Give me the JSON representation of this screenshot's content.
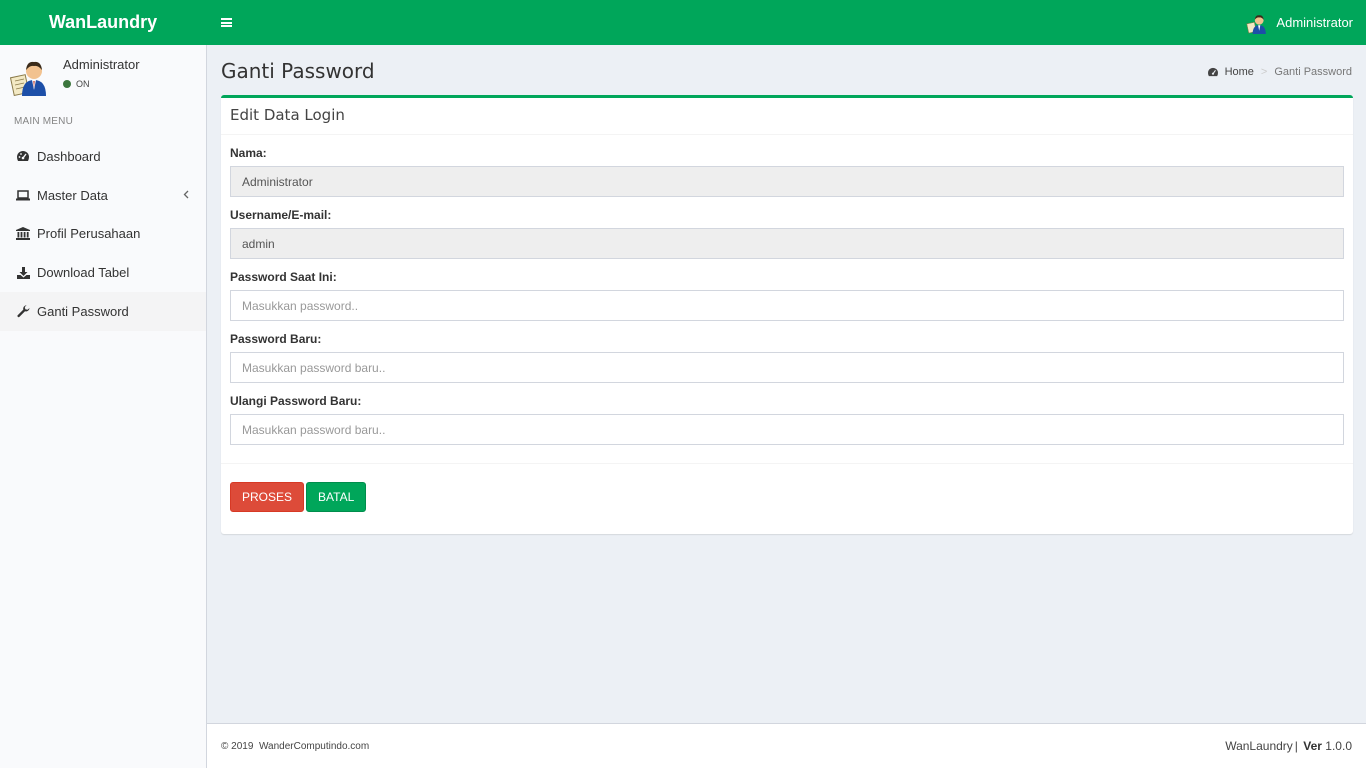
{
  "app": {
    "brand": "WanLaundry"
  },
  "header": {
    "user_name": "Administrator"
  },
  "sidebar": {
    "user_name": "Administrator",
    "status": "ON",
    "menu_header": "MAIN MENU",
    "items": [
      {
        "label": "Dashboard",
        "icon": "dashboard-icon"
      },
      {
        "label": "Master Data",
        "icon": "laptop-icon"
      },
      {
        "label": "Profil Perusahaan",
        "icon": "bank-icon"
      },
      {
        "label": "Download Tabel",
        "icon": "download-icon"
      },
      {
        "label": "Ganti Password",
        "icon": "wrench-icon"
      }
    ]
  },
  "page": {
    "title": "Ganti Password",
    "breadcrumb": {
      "home": "Home",
      "current": "Ganti Password"
    }
  },
  "box": {
    "title": "Edit Data Login"
  },
  "form": {
    "nama_label": "Nama:",
    "nama_value": "Administrator",
    "username_label": "Username/E-mail:",
    "username_value": "admin",
    "current_password_label": "Password Saat Ini:",
    "current_password_placeholder": "Masukkan password..",
    "new_password_label": "Password Baru:",
    "new_password_placeholder": "Masukkan password baru..",
    "repeat_password_label": "Ulangi Password Baru:",
    "repeat_password_placeholder": "Masukkan password baru.."
  },
  "actions": {
    "submit": "PROSES",
    "cancel": "BATAL"
  },
  "footer": {
    "copyright": "© 2019",
    "company": "WanderComputindo.com",
    "app_name": "WanLaundry",
    "version_label": "Ver",
    "version": "1.0.0"
  },
  "colors": {
    "primary": "#00a65a",
    "danger": "#dd4b39",
    "background": "#ecf0f5"
  }
}
